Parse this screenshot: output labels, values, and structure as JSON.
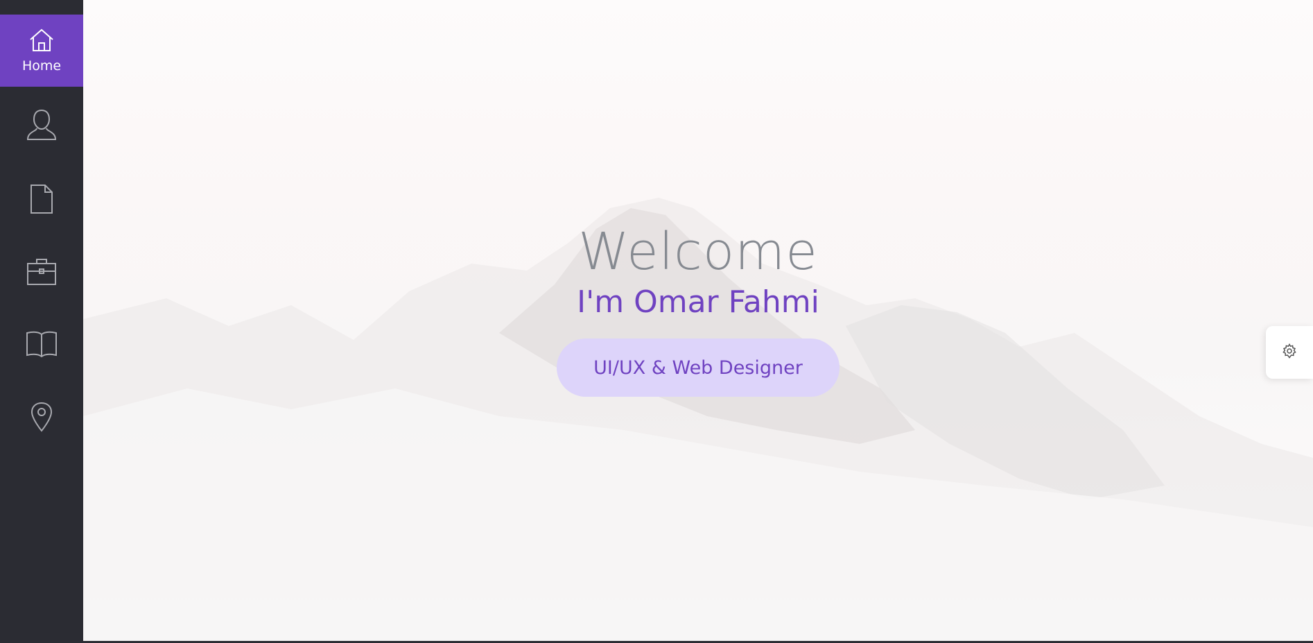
{
  "colors": {
    "accent": "#6f42c1",
    "sidebar_bg": "#2b2c33",
    "pill_bg": "#ddd4fa",
    "welcome_text": "#868a91"
  },
  "sidebar": {
    "items": [
      {
        "icon": "home-icon",
        "label": "Home",
        "active": true
      },
      {
        "icon": "user-icon",
        "label": "",
        "active": false
      },
      {
        "icon": "document-icon",
        "label": "",
        "active": false
      },
      {
        "icon": "briefcase-icon",
        "label": "",
        "active": false
      },
      {
        "icon": "book-icon",
        "label": "",
        "active": false
      },
      {
        "icon": "location-pin-icon",
        "label": "",
        "active": false
      }
    ]
  },
  "hero": {
    "welcome": "Welcome",
    "name": "I'm Omar Fahmi",
    "role": "UI/UX & Web Designer"
  },
  "settings": {
    "icon": "gear-icon"
  }
}
